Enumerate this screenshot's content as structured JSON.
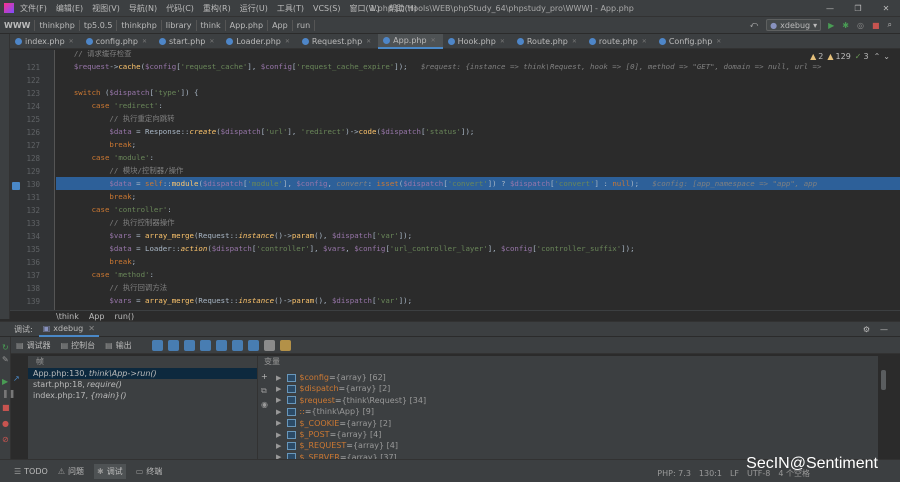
{
  "titlebar": {
    "menu": [
      "文件(F)",
      "编辑(E)",
      "视图(V)",
      "导航(N)",
      "代码(C)",
      "重构(R)",
      "运行(U)",
      "工具(T)",
      "VCS(S)",
      "窗口(W)",
      "帮助(H)"
    ],
    "title": "1.php [D:\\tools\\WEB\\phpStudy_64\\phpstudy_pro\\WWW] - App.php"
  },
  "navbar": {
    "crumbs": [
      "WWW",
      "thinkphp",
      "tp5.0.5",
      "thinkphp",
      "library",
      "think",
      "App.php",
      "App",
      "run"
    ],
    "run_config": "xdebug"
  },
  "tabs": [
    "index.php",
    "config.php",
    "start.php",
    "Loader.php",
    "Request.php",
    "App.php",
    "Hook.php",
    "Route.php",
    "route.php",
    "Config.php"
  ],
  "active_tab": 5,
  "inspections": {
    "warnings": "2",
    "weak": "129",
    "typos": "3"
  },
  "code_lines": [
    {
      "n": "",
      "text": "    // 请求缓存检查"
    },
    {
      "n": "121",
      "text": "    $request->cache($config['request_cache'], $config['request_cache_expire']);",
      "hint": "$request: {instance => think\\Request, hook => [0], method => \"GET\", domain => null, url =>"
    },
    {
      "n": "122",
      "text": ""
    },
    {
      "n": "123",
      "text": "    switch ($dispatch['type']) {"
    },
    {
      "n": "124",
      "text": "        case 'redirect':"
    },
    {
      "n": "125",
      "text": "            // 执行重定向跳转"
    },
    {
      "n": "126",
      "text": "            $data = Response::create($dispatch['url'], 'redirect')->code($dispatch['status']);"
    },
    {
      "n": "127",
      "text": "            break;"
    },
    {
      "n": "128",
      "text": "        case 'module':"
    },
    {
      "n": "129",
      "text": "            // 模块/控制器/操作"
    },
    {
      "n": "130",
      "text": "            $data = self::module($dispatch['module'], $config, convert: isset($dispatch['convert']) ? $dispatch['convert'] : null);",
      "hint": "$config: [app_namespace => \"app\", app"
    },
    {
      "n": "131",
      "text": "            break;"
    },
    {
      "n": "132",
      "text": "        case 'controller':"
    },
    {
      "n": "133",
      "text": "            // 执行控制器操作"
    },
    {
      "n": "134",
      "text": "            $vars = array_merge(Request::instance()->param(), $dispatch['var']);"
    },
    {
      "n": "135",
      "text": "            $data = Loader::action($dispatch['controller'], $vars, $config['url_controller_layer'], $config['controller_suffix']);"
    },
    {
      "n": "136",
      "text": "            break;"
    },
    {
      "n": "137",
      "text": "        case 'method':"
    },
    {
      "n": "138",
      "text": "            // 执行回调方法"
    },
    {
      "n": "139",
      "text": "            $vars = array_merge(Request::instance()->param(), $dispatch['var']);"
    }
  ],
  "editor_breadcrumb": [
    "\\think",
    "App",
    "run()"
  ],
  "debug": {
    "panel_label": "调试:",
    "config": "xdebug",
    "tool_tabs": [
      "调试器",
      "控制台",
      "输出"
    ],
    "frames_header": "帧",
    "vars_header": "变量",
    "frames": [
      {
        "file": "App.php:130,",
        "ctx": "think\\App->run()"
      },
      {
        "file": "start.php:18,",
        "ctx": "require()"
      },
      {
        "file": "index.php:17,",
        "ctx": "{main}()"
      }
    ],
    "variables": [
      {
        "name": "$config",
        "eq": " = ",
        "val": "{array} [62]"
      },
      {
        "name": "$dispatch",
        "eq": " = ",
        "val": "{array} [2]"
      },
      {
        "name": "$request",
        "eq": " = ",
        "val": "{think\\Request} [34]"
      },
      {
        "name": "::",
        "eq": " = ",
        "val": "{think\\App} [9]"
      },
      {
        "name": "$_COOKIE",
        "eq": " = ",
        "val": "{array} [2]"
      },
      {
        "name": "$_POST",
        "eq": " = ",
        "val": "{array} [4]"
      },
      {
        "name": "$_REQUEST",
        "eq": " = ",
        "val": "{array} [4]"
      },
      {
        "name": "$_SERVER",
        "eq": " = ",
        "val": "{array} [37]"
      }
    ]
  },
  "statusbar": {
    "tools": [
      "TODO",
      "问题",
      "调试",
      "终端"
    ],
    "right": [
      "PHP: 7.3",
      "130:1",
      "LF",
      "UTF-8",
      "4 个空格"
    ]
  },
  "watermark": "SecIN@Sentiment"
}
